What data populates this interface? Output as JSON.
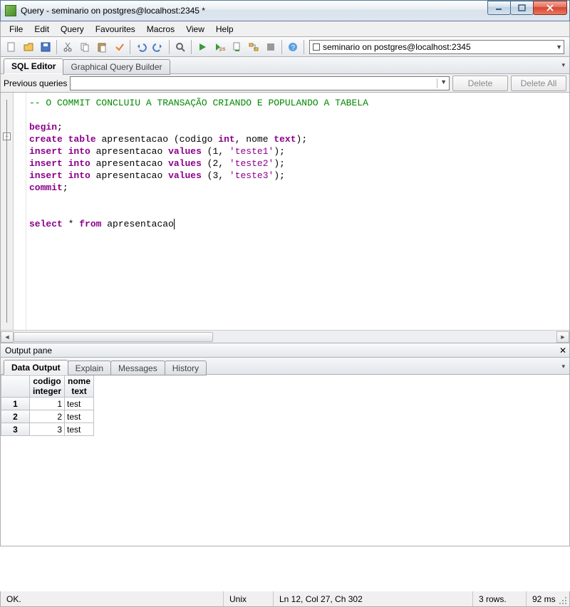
{
  "titlebar": {
    "title": "Query - seminario on postgres@localhost:2345 *"
  },
  "menu": {
    "items": [
      "File",
      "Edit",
      "Query",
      "Favourites",
      "Macros",
      "View",
      "Help"
    ]
  },
  "toolbar": {
    "connection": "seminario on postgres@localhost:2345"
  },
  "editor_tabs": {
    "active": "SQL Editor",
    "inactive": "Graphical Query Builder"
  },
  "prevq": {
    "label": "Previous queries",
    "delete": "Delete",
    "delete_all": "Delete All"
  },
  "code": {
    "comment": "-- O COMMIT CONCLUIU A TRANSAÇÃO CRIANDO E POPULANDO A TABELA",
    "l1_kw": "begin",
    "l1_rest": ";",
    "l2_kw1": "create",
    "l2_kw2": "table",
    "l2_mid": " apresentacao (codigo ",
    "l2_kw3": "int",
    "l2_mid2": ", nome ",
    "l2_kw4": "text",
    "l2_end": ");",
    "l3_kw1": "insert",
    "l3_kw2": "into",
    "l3_mid": " apresentacao ",
    "l3_kw3": "values",
    "l3_rest": " (1, ",
    "l3_str": "'teste1'",
    "l3_end": ");",
    "l4_kw1": "insert",
    "l4_kw2": "into",
    "l4_mid": " apresentacao ",
    "l4_kw3": "values",
    "l4_rest": " (2, ",
    "l4_str": "'teste2'",
    "l4_end": ");",
    "l5_kw1": "insert",
    "l5_kw2": "into",
    "l5_mid": " apresentacao ",
    "l5_kw3": "values",
    "l5_rest": " (3, ",
    "l5_str": "'teste3'",
    "l5_end": ");",
    "l6_kw": "commit",
    "l6_rest": ";",
    "l7_kw1": "select",
    "l7_mid1": " * ",
    "l7_kw2": "from",
    "l7_mid2": " apresentacao"
  },
  "output": {
    "pane_title": "Output pane",
    "tabs": {
      "active": "Data Output",
      "t1": "Explain",
      "t2": "Messages",
      "t3": "History"
    },
    "columns": [
      {
        "name": "codigo",
        "type": "integer"
      },
      {
        "name": "nome",
        "type": "text"
      }
    ],
    "rows": [
      {
        "n": "1",
        "codigo": "1",
        "nome": "test"
      },
      {
        "n": "2",
        "codigo": "2",
        "nome": "test"
      },
      {
        "n": "3",
        "codigo": "3",
        "nome": "test"
      }
    ]
  },
  "status": {
    "ok": "OK.",
    "enc": "Unix",
    "pos": "Ln 12, Col 27, Ch 302",
    "rows": "3 rows.",
    "time": "92 ms"
  }
}
